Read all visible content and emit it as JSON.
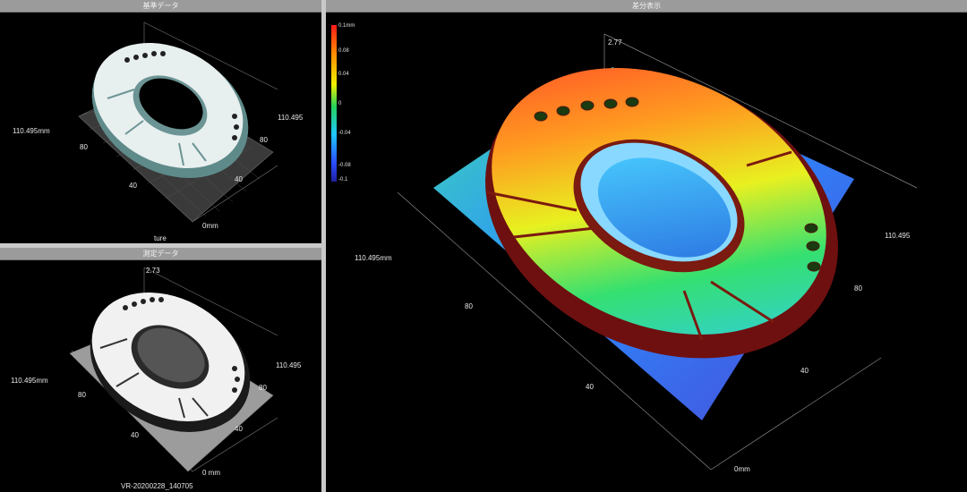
{
  "panels": {
    "reference": {
      "title": "基準データ",
      "axis": {
        "x_label": "110.495mm",
        "y_label": "110.495",
        "ticks_a": [
          "80",
          "40"
        ],
        "ticks_b": [
          "80",
          "40"
        ],
        "origin": "0mm"
      },
      "footer": "ture"
    },
    "measured": {
      "title": "測定データ",
      "axis": {
        "x_label": "110.495mm",
        "y_label": "110.495",
        "z_top": "2.73",
        "ticks_a": [
          "80",
          "40"
        ],
        "ticks_b": [
          "80",
          "40"
        ],
        "origin": "0 mm"
      },
      "footer": "VR-20200228_140705"
    },
    "difference": {
      "title": "差分表示",
      "axis": {
        "x_label": "110.495mm",
        "y_label": "110.495",
        "z_top": "2.77",
        "ticks_a": [
          "80",
          "40"
        ],
        "ticks_b": [
          "80",
          "40"
        ],
        "origin": "0mm"
      },
      "legend": {
        "labels": [
          "0.1mm",
          "0.08",
          "0.04",
          "0",
          "-0.04",
          "-0.08",
          "-0.1"
        ],
        "colors": [
          "#ff1a1a",
          "#ff8a00",
          "#f0f000",
          "#25d25a",
          "#1ec8ff",
          "#2a4dff",
          "#2020a0"
        ]
      }
    }
  }
}
